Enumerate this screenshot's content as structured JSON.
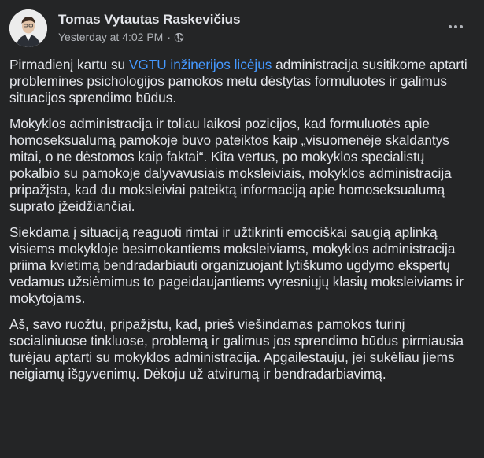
{
  "post": {
    "author": "Tomas Vytautas Raskevičius",
    "timestamp": "Yesterday at 4:02 PM",
    "separator": "·",
    "audience_icon": "globe-icon",
    "more_icon": "more-options-icon",
    "paragraphs": [
      {
        "before_link": "Pirmadienį kartu su ",
        "link": "VGTU inžinerijos licėjus",
        "after_link": " administracija susitikome aptarti problemines psichologijos pamokos metu dėstytas formuluotes ir galimus situacijos sprendimo būdus."
      },
      {
        "text": "Mokyklos administracija ir toliau laikosi pozicijos, kad formuluotės apie homoseksualumą pamokoje buvo pateiktos kaip „visuomenėje skaldantys mitai, o ne dėstomos kaip faktai“. Kita vertus, po mokyklos specialistų pokalbio su pamokoje dalyvavusiais moksleiviais, mokyklos administracija pripažįsta, kad du moksleiviai pateiktą informaciją apie homoseksualumą suprato įžeidžiančiai."
      },
      {
        "text": "Siekdama į situaciją reaguoti rimtai ir užtikrinti emociškai saugią aplinką visiems mokykloje besimokantiems moksleiviams, mokyklos administracija priima kvietimą bendradarbiauti organizuojant lytiškumo ugdymo ekspertų vedamus užsiėmimus to pageidaujantiems vyresniųjų klasių moksleiviams ir mokytojams."
      },
      {
        "text": "Aš, savo ruožtu, pripažįstu, kad, prieš viešindamas pamokos turinį socialiniuose tinkluose, problemą ir galimus jos sprendimo būdus pirmiausia turėjau aptarti su mokyklos administracija. Apgailestauju, jei sukėliau jiems neigiamų išgyvenimų. Dėkoju už atvirumą ir bendradarbiavimą."
      }
    ]
  },
  "colors": {
    "background": "#242526",
    "primary_text": "#e4e6eb",
    "secondary_text": "#b0b3b8",
    "link": "#4599ff"
  }
}
